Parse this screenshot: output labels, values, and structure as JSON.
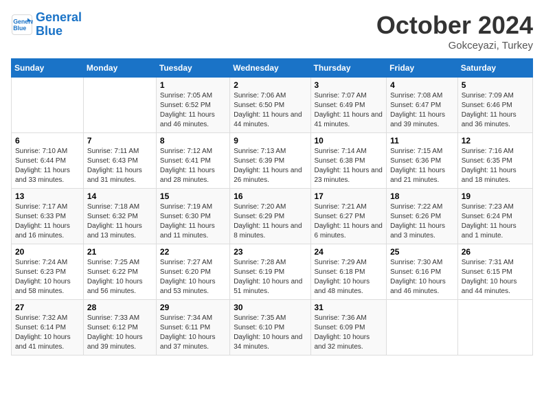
{
  "header": {
    "logo_line1": "General",
    "logo_line2": "Blue",
    "month": "October 2024",
    "location": "Gokceyazi, Turkey"
  },
  "weekdays": [
    "Sunday",
    "Monday",
    "Tuesday",
    "Wednesday",
    "Thursday",
    "Friday",
    "Saturday"
  ],
  "weeks": [
    [
      {
        "day": "",
        "info": ""
      },
      {
        "day": "",
        "info": ""
      },
      {
        "day": "1",
        "info": "Sunrise: 7:05 AM\nSunset: 6:52 PM\nDaylight: 11 hours and 46 minutes."
      },
      {
        "day": "2",
        "info": "Sunrise: 7:06 AM\nSunset: 6:50 PM\nDaylight: 11 hours and 44 minutes."
      },
      {
        "day": "3",
        "info": "Sunrise: 7:07 AM\nSunset: 6:49 PM\nDaylight: 11 hours and 41 minutes."
      },
      {
        "day": "4",
        "info": "Sunrise: 7:08 AM\nSunset: 6:47 PM\nDaylight: 11 hours and 39 minutes."
      },
      {
        "day": "5",
        "info": "Sunrise: 7:09 AM\nSunset: 6:46 PM\nDaylight: 11 hours and 36 minutes."
      }
    ],
    [
      {
        "day": "6",
        "info": "Sunrise: 7:10 AM\nSunset: 6:44 PM\nDaylight: 11 hours and 33 minutes."
      },
      {
        "day": "7",
        "info": "Sunrise: 7:11 AM\nSunset: 6:43 PM\nDaylight: 11 hours and 31 minutes."
      },
      {
        "day": "8",
        "info": "Sunrise: 7:12 AM\nSunset: 6:41 PM\nDaylight: 11 hours and 28 minutes."
      },
      {
        "day": "9",
        "info": "Sunrise: 7:13 AM\nSunset: 6:39 PM\nDaylight: 11 hours and 26 minutes."
      },
      {
        "day": "10",
        "info": "Sunrise: 7:14 AM\nSunset: 6:38 PM\nDaylight: 11 hours and 23 minutes."
      },
      {
        "day": "11",
        "info": "Sunrise: 7:15 AM\nSunset: 6:36 PM\nDaylight: 11 hours and 21 minutes."
      },
      {
        "day": "12",
        "info": "Sunrise: 7:16 AM\nSunset: 6:35 PM\nDaylight: 11 hours and 18 minutes."
      }
    ],
    [
      {
        "day": "13",
        "info": "Sunrise: 7:17 AM\nSunset: 6:33 PM\nDaylight: 11 hours and 16 minutes."
      },
      {
        "day": "14",
        "info": "Sunrise: 7:18 AM\nSunset: 6:32 PM\nDaylight: 11 hours and 13 minutes."
      },
      {
        "day": "15",
        "info": "Sunrise: 7:19 AM\nSunset: 6:30 PM\nDaylight: 11 hours and 11 minutes."
      },
      {
        "day": "16",
        "info": "Sunrise: 7:20 AM\nSunset: 6:29 PM\nDaylight: 11 hours and 8 minutes."
      },
      {
        "day": "17",
        "info": "Sunrise: 7:21 AM\nSunset: 6:27 PM\nDaylight: 11 hours and 6 minutes."
      },
      {
        "day": "18",
        "info": "Sunrise: 7:22 AM\nSunset: 6:26 PM\nDaylight: 11 hours and 3 minutes."
      },
      {
        "day": "19",
        "info": "Sunrise: 7:23 AM\nSunset: 6:24 PM\nDaylight: 11 hours and 1 minute."
      }
    ],
    [
      {
        "day": "20",
        "info": "Sunrise: 7:24 AM\nSunset: 6:23 PM\nDaylight: 10 hours and 58 minutes."
      },
      {
        "day": "21",
        "info": "Sunrise: 7:25 AM\nSunset: 6:22 PM\nDaylight: 10 hours and 56 minutes."
      },
      {
        "day": "22",
        "info": "Sunrise: 7:27 AM\nSunset: 6:20 PM\nDaylight: 10 hours and 53 minutes."
      },
      {
        "day": "23",
        "info": "Sunrise: 7:28 AM\nSunset: 6:19 PM\nDaylight: 10 hours and 51 minutes."
      },
      {
        "day": "24",
        "info": "Sunrise: 7:29 AM\nSunset: 6:18 PM\nDaylight: 10 hours and 48 minutes."
      },
      {
        "day": "25",
        "info": "Sunrise: 7:30 AM\nSunset: 6:16 PM\nDaylight: 10 hours and 46 minutes."
      },
      {
        "day": "26",
        "info": "Sunrise: 7:31 AM\nSunset: 6:15 PM\nDaylight: 10 hours and 44 minutes."
      }
    ],
    [
      {
        "day": "27",
        "info": "Sunrise: 7:32 AM\nSunset: 6:14 PM\nDaylight: 10 hours and 41 minutes."
      },
      {
        "day": "28",
        "info": "Sunrise: 7:33 AM\nSunset: 6:12 PM\nDaylight: 10 hours and 39 minutes."
      },
      {
        "day": "29",
        "info": "Sunrise: 7:34 AM\nSunset: 6:11 PM\nDaylight: 10 hours and 37 minutes."
      },
      {
        "day": "30",
        "info": "Sunrise: 7:35 AM\nSunset: 6:10 PM\nDaylight: 10 hours and 34 minutes."
      },
      {
        "day": "31",
        "info": "Sunrise: 7:36 AM\nSunset: 6:09 PM\nDaylight: 10 hours and 32 minutes."
      },
      {
        "day": "",
        "info": ""
      },
      {
        "day": "",
        "info": ""
      }
    ]
  ]
}
